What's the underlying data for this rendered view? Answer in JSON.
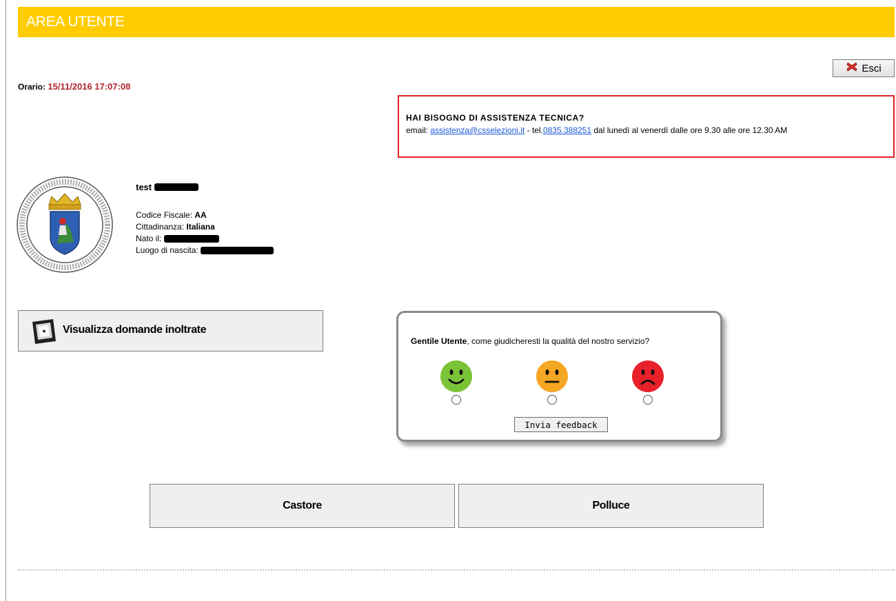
{
  "header": {
    "title": "AREA UTENTE"
  },
  "logout": {
    "label": "Esci",
    "icon": "red-x-icon"
  },
  "clock": {
    "label": "Orario:",
    "value": "15/11/2016 17:07:08",
    "value_color": "#b3242e"
  },
  "support": {
    "title": "HAI BISOGNO DI ASSISTENZA TECNICA?",
    "email_label": "email:",
    "email": "assistenza@csselezioni.it",
    "phone_label": "- tel.",
    "phone": "0835.388251",
    "hours": "dal lunedì al venerdì dalle ore 9.30 alle ore 12.30 AM",
    "border_color": "#e02020"
  },
  "profile": {
    "name": "test",
    "fiscal_code_label": "Codice Fiscale:",
    "fiscal_code": "AA",
    "citizenship_label": "Cittadinanza:",
    "citizenship": "Italiana",
    "birth_date_label": "Nato il:",
    "birth_place_label": "Luogo di nascita:"
  },
  "requests_button": {
    "label": "Visualizza domande inoltrate",
    "icon": "document-view-icon"
  },
  "feedback": {
    "question_bold": "Gentile Utente",
    "question_rest": ", come giudicheresti la qualità del nostro servizio?",
    "options": [
      {
        "mood": "happy",
        "color": "#7bc337"
      },
      {
        "mood": "neutral",
        "color": "#f5a623"
      },
      {
        "mood": "sad",
        "color": "#e8202a"
      }
    ],
    "send_label": "Invia feedback"
  },
  "nav": {
    "castore": "Castore",
    "polluce": "Polluce"
  },
  "header_color": "#ffcc00"
}
